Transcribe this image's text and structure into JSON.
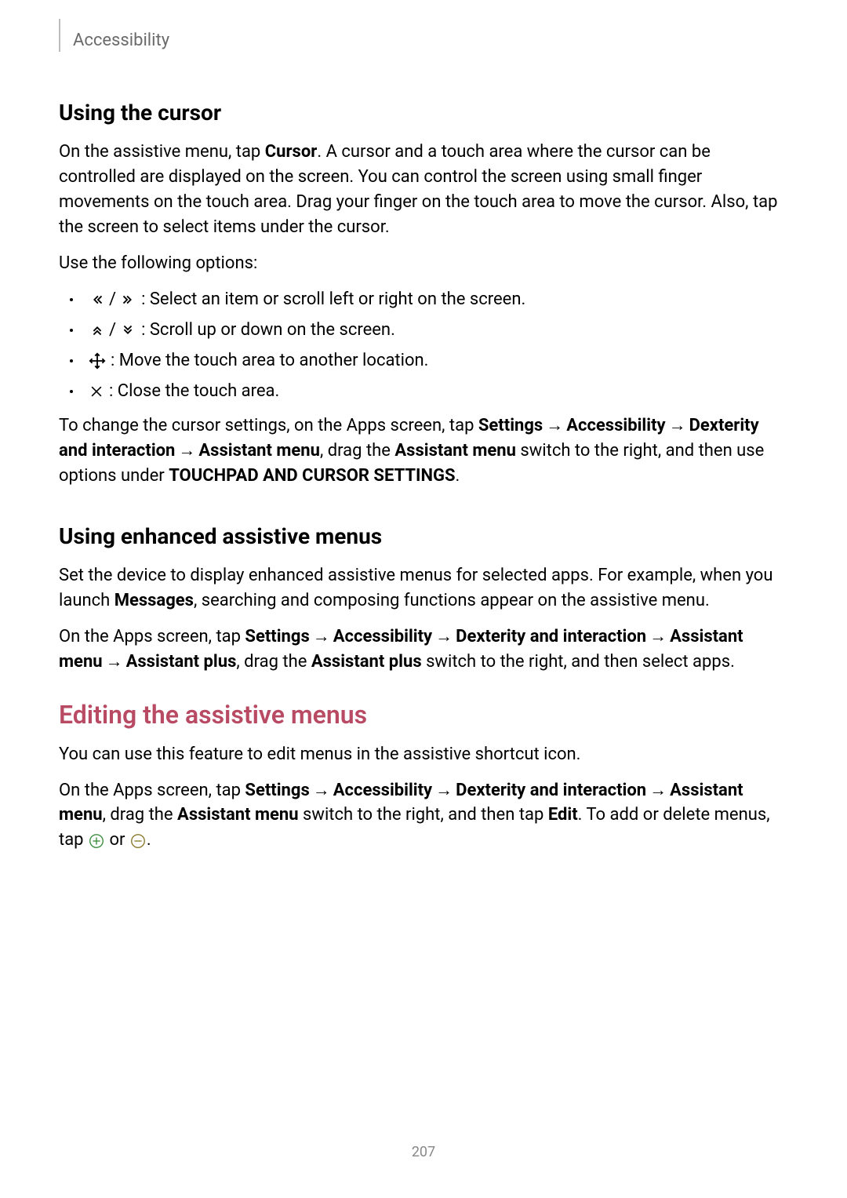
{
  "header": {
    "breadcrumb": "Accessibility"
  },
  "section1": {
    "heading": "Using the cursor",
    "para1_pre": "On the assistive menu, tap ",
    "para1_bold": "Cursor",
    "para1_post": ". A cursor and a touch area where the cursor can be controlled are displayed on the screen. You can control the screen using small finger movements on the touch area. Drag your finger on the touch area to move the cursor. Also, tap the screen to select items under the cursor.",
    "para2": "Use the following options:",
    "bullets": {
      "b1": " : Select an item or scroll left or right on the screen.",
      "b2": " : Scroll up or down on the screen.",
      "b3": " : Move the touch area to another location.",
      "b4": " : Close the touch area."
    },
    "para3": {
      "t1": "To change the cursor settings, on the Apps screen, tap ",
      "b1": "Settings",
      "arr": " → ",
      "b2": "Accessibility",
      "b3": "Dexterity and interaction",
      "b4": "Assistant menu",
      "t2": ", drag the ",
      "b5": "Assistant menu",
      "t3": " switch to the right, and then use options under ",
      "b6": "TOUCHPAD AND CURSOR SETTINGS",
      "t4": "."
    }
  },
  "section2": {
    "heading": "Using enhanced assistive menus",
    "para1": {
      "t1": "Set the device to display enhanced assistive menus for selected apps. For example, when you launch ",
      "b1": "Messages",
      "t2": ", searching and composing functions appear on the assistive menu."
    },
    "para2": {
      "t1": "On the Apps screen, tap ",
      "b1": "Settings",
      "arr": " → ",
      "b2": "Accessibility",
      "b3": "Dexterity and interaction",
      "b4": "Assistant menu",
      "b5": "Assistant plus",
      "t2": ", drag the ",
      "b6": "Assistant plus",
      "t3": " switch to the right, and then select apps."
    }
  },
  "section3": {
    "heading": "Editing the assistive menus",
    "para1": "You can use this feature to edit menus in the assistive shortcut icon.",
    "para2": {
      "t1": "On the Apps screen, tap ",
      "b1": "Settings",
      "arr": " → ",
      "b2": "Accessibility",
      "b3": "Dexterity and interaction",
      "b4": "Assistant menu",
      "t2": ", drag the ",
      "b5": "Assistant menu",
      "t3": " switch to the right, and then tap ",
      "b6": "Edit",
      "t4": ". To add or delete menus, tap ",
      "t5": " or ",
      "t6": "."
    }
  },
  "pageNumber": "207"
}
